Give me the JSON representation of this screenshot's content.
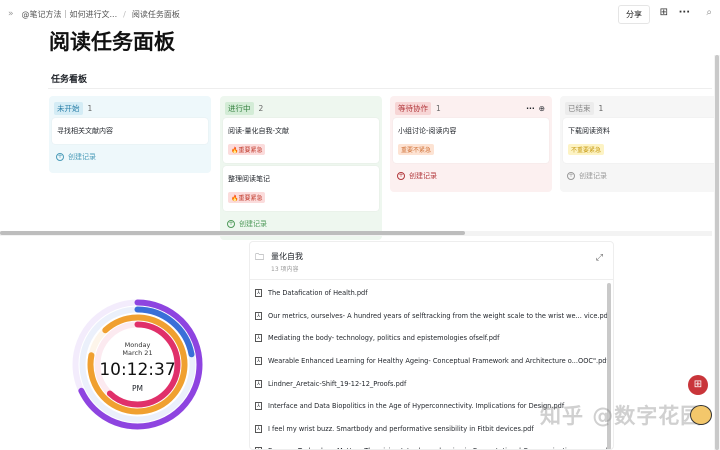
{
  "topbar": {
    "breadcrumb": [
      "@笔记方法｜如何进行文...",
      "阅读任务面板"
    ],
    "share": "分享"
  },
  "page": {
    "title": "阅读任务面板",
    "section": "任务看板"
  },
  "columns": [
    {
      "name": "未开始",
      "count": "1",
      "bg": "#eef8fb",
      "badge_bg": "#d4ecf5",
      "badge_color": "#2a7fa8",
      "cards": [
        {
          "title": "寻找相关文献内容"
        }
      ],
      "create": "创建记录",
      "create_color": "#4a9bb8"
    },
    {
      "name": "进行中",
      "count": "2",
      "bg": "#eef7ef",
      "badge_bg": "#d3ecd6",
      "badge_color": "#2f7d3b",
      "cards": [
        {
          "title": "阅读-量化自我-文献",
          "tag": "🔥重要紧急"
        },
        {
          "title": "整理阅读笔记",
          "tag": "🔥重要紧急"
        }
      ],
      "create": "创建记录",
      "create_color": "#4f9a5a"
    },
    {
      "name": "等待协作",
      "count": "1",
      "bg": "#fcf0f0",
      "badge_bg": "#f7d5d5",
      "badge_color": "#b2383c",
      "cards": [
        {
          "title": "小组讨论-阅读内容",
          "tag": "重要不紧急"
        }
      ],
      "create": "创建记录",
      "create_color": "#b2383c"
    },
    {
      "name": "已结束",
      "count": "1",
      "bg": "#f6f6f6",
      "badge_bg": "#ececec",
      "badge_color": "#888",
      "cards": [
        {
          "title": "下载阅读资料",
          "tag": "不重要紧急"
        }
      ],
      "create": "创建记录",
      "create_color": "#999"
    }
  ],
  "tags": {
    "🔥重要紧急": {
      "bg": "#fbdcdc",
      "color": "#c0392b"
    },
    "重要不紧急": {
      "bg": "#fde3d3",
      "color": "#d0733a"
    },
    "不重要紧急": {
      "bg": "#fdf3c4",
      "color": "#c79a12"
    }
  },
  "folder": {
    "name": "量化自我",
    "count": "13 项内容",
    "files": [
      "The Datafication of Health.pdf",
      "Our metrics, ourselves- A hundred years of selftracking from the weight scale to the wrist we...  vice.pdf",
      "Mediating the body- technology, politics and epistemologies ofself.pdf",
      "Wearable Enhanced Learning for Healthy Ageing- Conceptual Framework and Architecture o...OOC\".pdf",
      "Lindner_Aretaic-Shift_19-12-12_Proofs.pdf",
      "Interface and Data Biopolitics in the Age of Hyperconnectivity. Implications for Design.pdf",
      "I feel my wrist buzz. Smartbody and performative sensibility in Fitbit devices.pdf",
      "Because Technology Matters Theorizing Interdependencies in Computational Communication... eory.pdf"
    ]
  },
  "clock": {
    "day": "Monday",
    "date": "March 21",
    "time": "10:12:37",
    "ampm": "PM",
    "rings": [
      {
        "color": "#8e44e0",
        "fraction": 0.68
      },
      {
        "color": "#3a6fd8",
        "fraction": 0.22
      },
      {
        "color": "#f0a030",
        "fraction": 0.9,
        "start": -0.12
      },
      {
        "color": "#e0306a",
        "fraction": 0.62
      }
    ]
  },
  "watermark": "知乎 @数字花园"
}
